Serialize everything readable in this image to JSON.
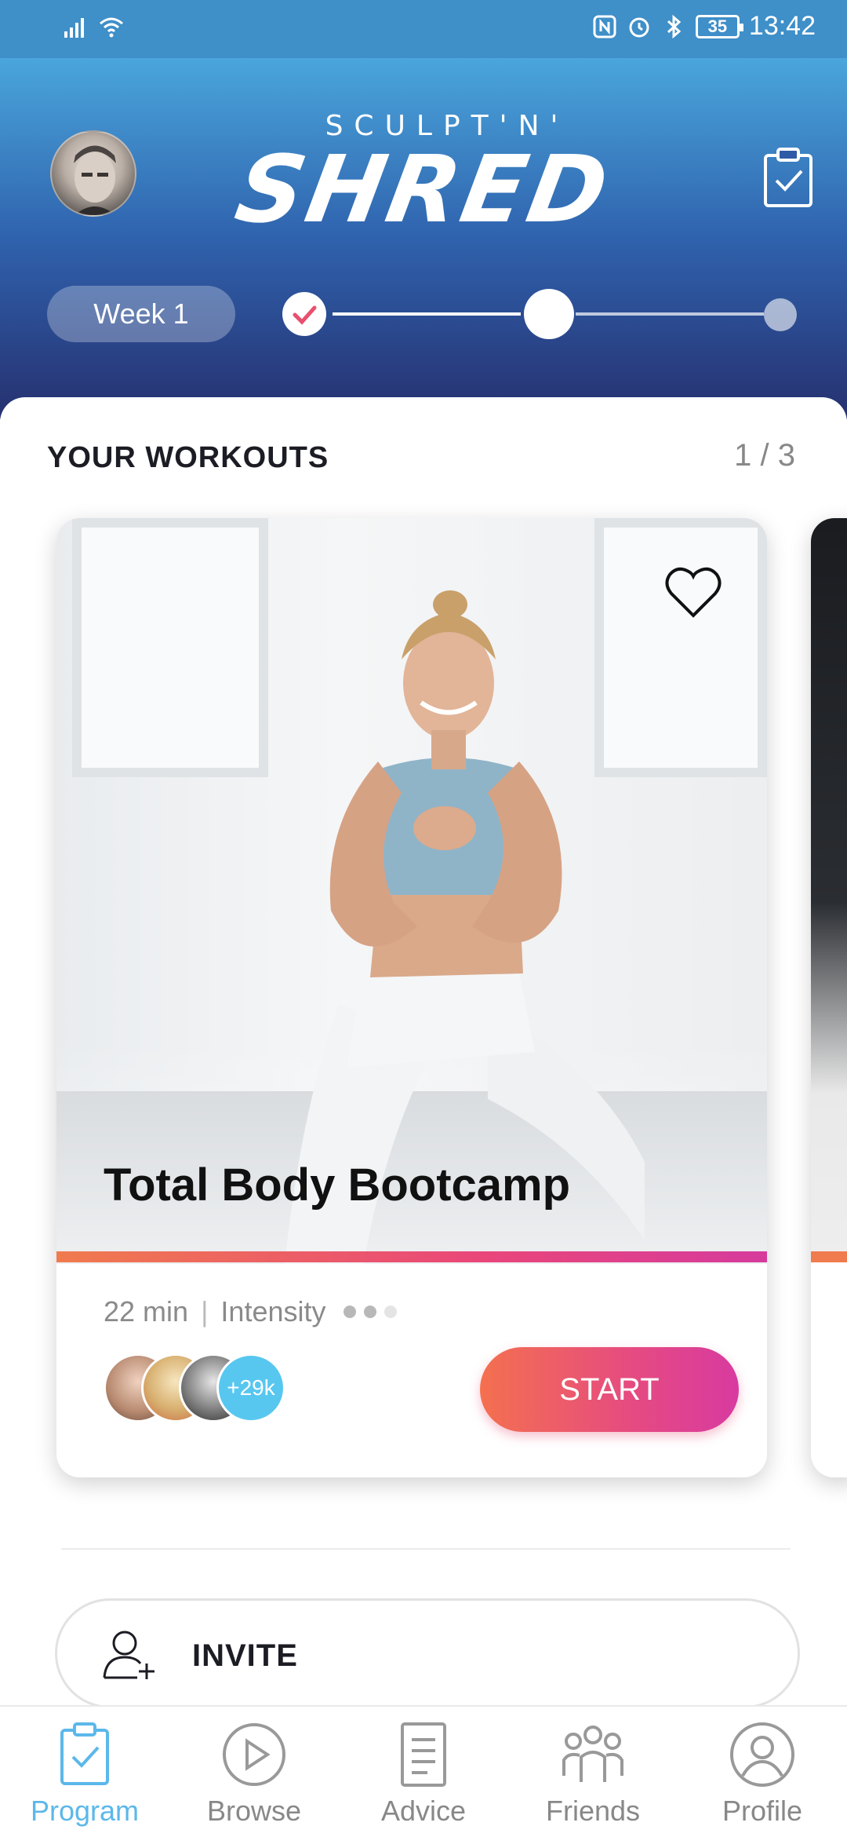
{
  "status_bar": {
    "time": "13:42",
    "battery": "35",
    "icons": [
      "signal-icon",
      "wifi-icon",
      "nfc-icon",
      "alarm-icon",
      "bluetooth-icon",
      "battery-icon"
    ]
  },
  "header": {
    "logo_top": "SCULPT'N'",
    "logo_main": "SHRED",
    "week_label": "Week 1",
    "progress": {
      "completed_steps": 1,
      "current_step": 2,
      "total_steps": 3
    },
    "icons": [
      "avatar",
      "clipboard-check-icon"
    ]
  },
  "workouts": {
    "section_title": "YOUR WORKOUTS",
    "pager": "1 / 3",
    "card": {
      "title": "Total Body Bootcamp",
      "duration": "22 min",
      "separator": "|",
      "intensity_label": "Intensity",
      "intensity_level": 2,
      "intensity_max": 3,
      "participants_count": "+29k",
      "start_label": "START",
      "favorite_icon": "heart-outline-icon"
    }
  },
  "invite": {
    "label": "INVITE",
    "icon": "add-user-icon"
  },
  "bottom_nav": {
    "items": [
      {
        "label": "Program",
        "icon": "clipboard-check-icon",
        "active": true
      },
      {
        "label": "Browse",
        "icon": "play-circle-icon",
        "active": false
      },
      {
        "label": "Advice",
        "icon": "document-icon",
        "active": false
      },
      {
        "label": "Friends",
        "icon": "group-icon",
        "active": false
      },
      {
        "label": "Profile",
        "icon": "user-circle-icon",
        "active": false
      }
    ]
  },
  "colors": {
    "header_top": "#4aa6dc",
    "header_bottom": "#26306f",
    "accent_start": "#f4704f",
    "accent_end": "#d83aa0",
    "nav_active": "#5bb8ea",
    "check_pink": "#e8506e"
  }
}
